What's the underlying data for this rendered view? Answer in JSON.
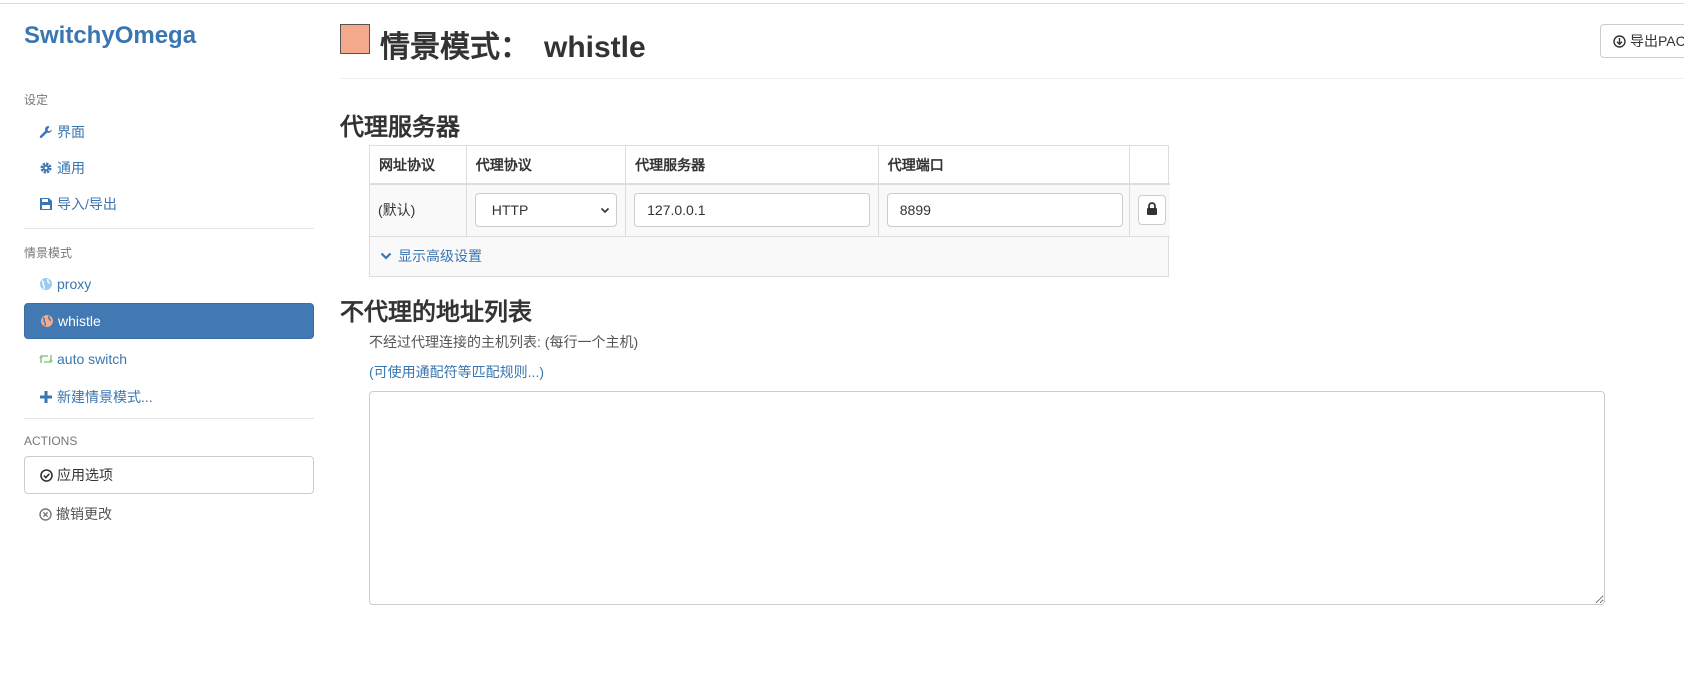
{
  "app": {
    "brand": "SwitchyOmega"
  },
  "sidebar": {
    "settings_header": "设定",
    "settings_items": [
      {
        "label": "界面",
        "icon": "wrench-icon"
      },
      {
        "label": "通用",
        "icon": "gear-icon"
      },
      {
        "label": "导入/导出",
        "icon": "floppy-disk-icon"
      }
    ],
    "profiles_header": "情景模式",
    "profiles": [
      {
        "label": "proxy",
        "icon": "globe-icon",
        "color": "#99ccee"
      },
      {
        "label": "whistle",
        "icon": "globe-icon",
        "color": "#f4a98c",
        "active": true
      },
      {
        "label": "auto switch",
        "icon": "retweet-icon",
        "color": "#99dd99"
      }
    ],
    "new_profile_label": "新建情景模式...",
    "actions_header": "ACTIONS",
    "apply_label": "应用选项",
    "discard_label": "撤销更改"
  },
  "header": {
    "profile_color": "#f4a98c",
    "title_prefix": "情景模式：",
    "profile_name": "whistle",
    "export_pac_label": "导出PAC"
  },
  "proxy_section": {
    "title": "代理服务器",
    "columns": [
      "网址协议",
      "代理协议",
      "代理服务器",
      "代理端口"
    ],
    "rows": [
      {
        "scheme": "(默认)",
        "protocol": "HTTP",
        "server": "127.0.0.1",
        "port": "8899"
      }
    ],
    "advanced_label": "显示高级设置"
  },
  "bypass_section": {
    "title": "不代理的地址列表",
    "help_text": "不经过代理连接的主机列表: (每行一个主机)",
    "wildcard_link": "(可使用通配符等匹配规则...)",
    "list_value": ""
  },
  "colors": {
    "accent": "#3a76b1",
    "active_bg": "#4279b3"
  }
}
